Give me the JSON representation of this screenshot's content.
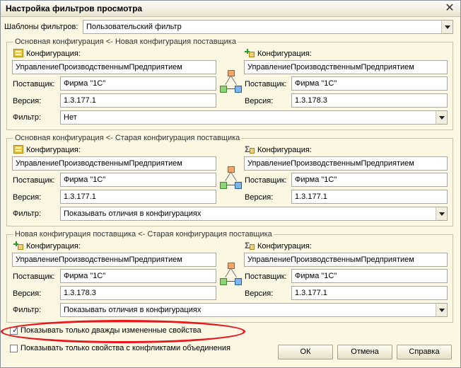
{
  "window": {
    "title": "Настройка фильтров просмотра",
    "close": "✕"
  },
  "templates": {
    "label": "Шаблоны фильтров:",
    "value": "Пользовательский фильтр"
  },
  "groups": [
    {
      "title": "Основная конфигурация <- Новая конфигурация поставщика",
      "left_icon": "config-icon",
      "right_icon": "config-add-icon",
      "left": {
        "config_label": "Конфигурация:",
        "config": "УправлениеПроизводственнымПредприятием",
        "vendor_label": "Поставщик:",
        "vendor": "Фирма \"1С\"",
        "version_label": "Версия:",
        "version": "1.3.177.1"
      },
      "right": {
        "config_label": "Конфигурация:",
        "config": "УправлениеПроизводственнымПредприятием",
        "vendor_label": "Поставщик:",
        "vendor": "Фирма \"1С\"",
        "version_label": "Версия:",
        "version": "1.3.178.3"
      },
      "filter_label": "Фильтр:",
      "filter": "Нет"
    },
    {
      "title": "Основная конфигурация <- Старая конфигурация поставщика",
      "left_icon": "config-icon",
      "right_icon": "config-old-icon",
      "left": {
        "config_label": "Конфигурация:",
        "config": "УправлениеПроизводственнымПредприятием",
        "vendor_label": "Поставщик:",
        "vendor": "Фирма \"1С\"",
        "version_label": "Версия:",
        "version": "1.3.177.1"
      },
      "right": {
        "config_label": "Конфигурация:",
        "config": "УправлениеПроизводственнымПредприятием",
        "vendor_label": "Поставщик:",
        "vendor": "Фирма \"1С\"",
        "version_label": "Версия:",
        "version": "1.3.177.1"
      },
      "filter_label": "Фильтр:",
      "filter": "Показывать отличия в конфигурациях"
    },
    {
      "title": "Новая конфигурация поставщика <- Старая конфигурация поставщика",
      "left_icon": "config-add-icon",
      "right_icon": "config-old-icon",
      "left": {
        "config_label": "Конфигурация:",
        "config": "УправлениеПроизводственнымПредприятием",
        "vendor_label": "Поставщик:",
        "vendor": "Фирма \"1С\"",
        "version_label": "Версия:",
        "version": "1.3.178.3"
      },
      "right": {
        "config_label": "Конфигурация:",
        "config": "УправлениеПроизводственнымПредприятием",
        "vendor_label": "Поставщик:",
        "vendor": "Фирма \"1С\"",
        "version_label": "Версия:",
        "version": "1.3.177.1"
      },
      "filter_label": "Фильтр:",
      "filter": "Показывать отличия в конфигурациях"
    }
  ],
  "options": {
    "twice_changed": {
      "label": "Показывать только дважды измененные свойства",
      "checked": true
    },
    "conflicts": {
      "label": "Показывать только свойства с конфликтами объединения",
      "checked": false
    }
  },
  "buttons": {
    "ok": "ОК",
    "cancel": "Отмена",
    "help": "Справка"
  },
  "colors": {
    "highlight_ellipse": "#e8161d",
    "dialog_bg": "#fbf7e3"
  }
}
